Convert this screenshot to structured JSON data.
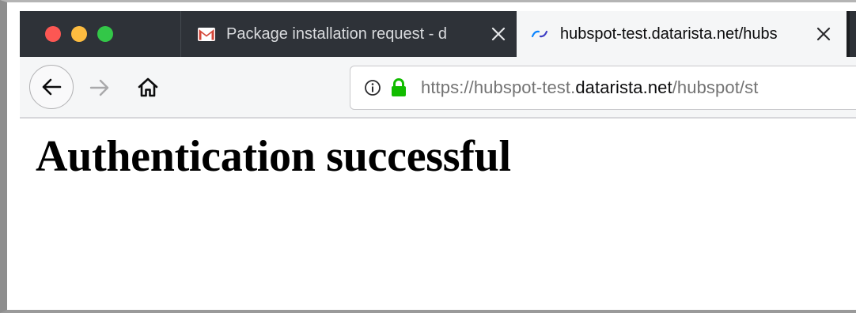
{
  "window": {
    "controls": [
      "close",
      "minimize",
      "maximize"
    ]
  },
  "tabs": [
    {
      "title": "Package installation request - d",
      "favicon": "gmail-icon",
      "active": false
    },
    {
      "title": "hubspot-test.datarista.net/hubs",
      "favicon": "loading-spinner-icon",
      "active": true
    }
  ],
  "navigation": {
    "back_icon": "arrow-left-icon",
    "forward_icon": "arrow-right-icon",
    "home_icon": "home-icon"
  },
  "address_bar": {
    "info_icon": "info-icon",
    "lock_icon": "lock-icon",
    "url_prefix": "https://hubspot-test.",
    "url_host": "datarista.net",
    "url_path": "/hubspot/st"
  },
  "page": {
    "heading": "Authentication successful"
  },
  "colors": {
    "tabstrip_bg": "#2e3238",
    "toolbar_bg": "#f5f6f7",
    "lock_green": "#12bc00",
    "gmail_red": "#d44638",
    "spinner_blue": "#0a84ff"
  }
}
